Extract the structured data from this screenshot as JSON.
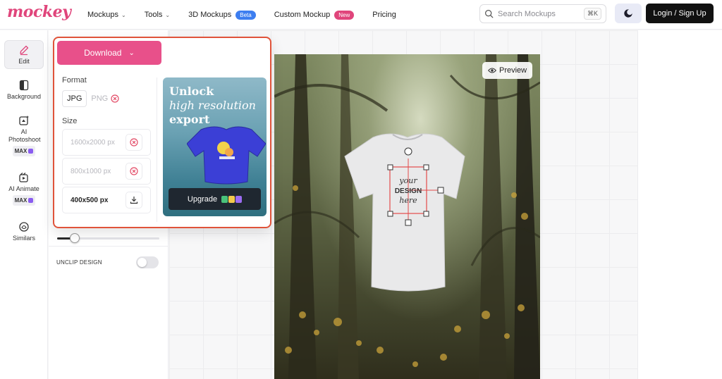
{
  "header": {
    "logo": "mockey",
    "nav": [
      {
        "label": "Mockups",
        "dropdown": true
      },
      {
        "label": "Tools",
        "dropdown": true
      },
      {
        "label": "3D Mockups",
        "badge": "Beta"
      },
      {
        "label": "Custom Mockup",
        "badge": "New"
      },
      {
        "label": "Pricing"
      }
    ],
    "search_placeholder": "Search Mockups",
    "search_shortcut": "⌘K",
    "login_label": "Login / Sign Up"
  },
  "rail": {
    "items": [
      {
        "label": "Edit",
        "icon": "pencil-icon",
        "active": true
      },
      {
        "label": "Background",
        "icon": "background-icon"
      },
      {
        "label": "AI Photoshoot",
        "icon": "ai-photoshoot-icon",
        "badge": "MAX"
      },
      {
        "label": "AI Animate",
        "icon": "ai-animate-icon",
        "badge": "MAX"
      },
      {
        "label": "Similars",
        "icon": "similars-icon"
      }
    ]
  },
  "panel": {
    "slider_value": 0.17,
    "unclip_label": "UNCLIP DESIGN",
    "unclip_on": false
  },
  "download": {
    "button_label": "Download",
    "format_label": "Format",
    "formats": [
      {
        "label": "JPG",
        "selected": true
      },
      {
        "label": "PNG",
        "disabled": true
      }
    ],
    "size_label": "Size",
    "sizes": [
      {
        "label": "1600x2000 px",
        "locked": true
      },
      {
        "label": "800x1000 px",
        "locked": true
      },
      {
        "label": "400x500 px",
        "locked": false
      }
    ],
    "promo": {
      "line1": "Unlock",
      "line2": "high resolution",
      "line3": "export",
      "upgrade_label": "Upgrade"
    }
  },
  "canvas": {
    "preview_label": "Preview",
    "design_text": {
      "top": "your",
      "middle": "DESIGN",
      "bottom": "here"
    }
  },
  "colors": {
    "brand_pink": "#e8508a",
    "highlight_border": "#e0533a"
  }
}
